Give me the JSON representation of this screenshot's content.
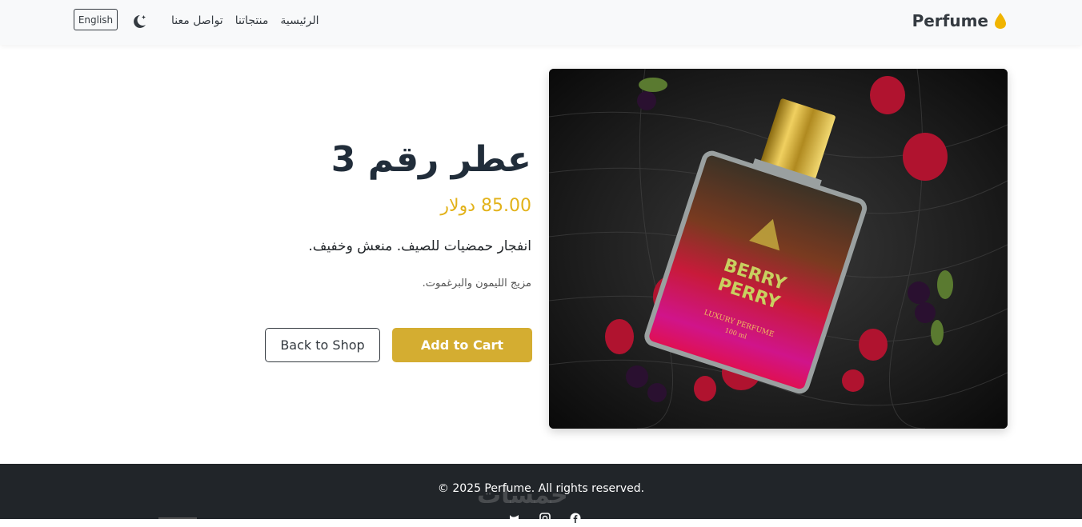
{
  "navbar": {
    "brand": "Perfume",
    "links": [
      "الرئيسية",
      "منتجاتنا",
      "تواصل معنا"
    ],
    "language_button": "English",
    "icons": {
      "brand": "drop-icon",
      "theme": "moon-icon"
    },
    "colors": {
      "drop": "#f0b400"
    }
  },
  "product": {
    "title": "عطر رقم 3",
    "price": "85.00 دولار",
    "description": "انفجار حمضيات للصيف. منعش وخفيف.",
    "notes": "مزيج الليمون والبرغموت.",
    "image_label": {
      "line1": "BERRY",
      "line2": "PERRY",
      "line3": "LUXURY PERFUME",
      "line4": "100 ml"
    },
    "add_to_cart": "Add to Cart",
    "back_to_shop": "Back to Shop"
  },
  "footer": {
    "copyright": "© 2025 Perfume. All rights reserved.",
    "watermark": "خمسات",
    "social": [
      "twitter-icon",
      "instagram-icon",
      "facebook-icon"
    ]
  },
  "colors": {
    "accent": "#d4ad31",
    "price": "#e2b21a",
    "footer_bg": "#212529",
    "nav_bg": "#f8f9fa"
  }
}
